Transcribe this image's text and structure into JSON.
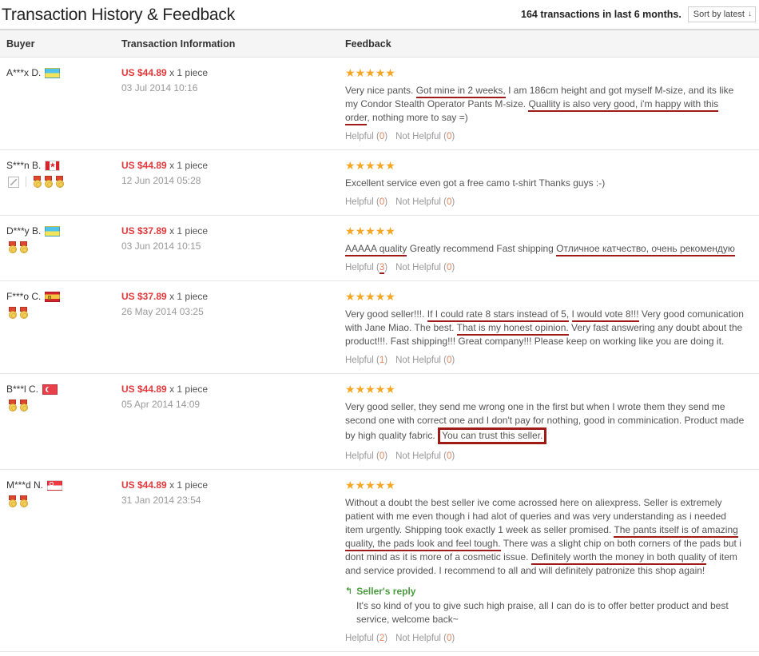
{
  "header": {
    "title": "Transaction History & Feedback",
    "transactions_summary": "164 transactions in last 6 months.",
    "sort_label": "Sort by latest",
    "sort_arrow": "↓"
  },
  "table": {
    "columns": {
      "buyer": "Buyer",
      "transaction_information": "Transaction Information",
      "feedback": "Feedback"
    },
    "helpful_label": "Helpful",
    "not_helpful_label": "Not Helpful",
    "quantity_suffix": "x 1 piece",
    "seller_reply_label": "Seller's reply",
    "seller_reply_icon": "reply-arrow-icon"
  },
  "rows": [
    {
      "buyer": "A***x D.",
      "flag": "flag-ua",
      "flag_name": "ukraine",
      "has_photo_icon": false,
      "medals": 0,
      "price": "US $44.89",
      "qty": "x 1 piece",
      "date": "03 Jul 2014 10:16",
      "stars": 5,
      "feedback_parts": [
        {
          "t": "Very nice pants. ",
          "s": "plain"
        },
        {
          "t": "Got mine in 2 weeks,",
          "s": "underline"
        },
        {
          "t": " I am 186cm height and got myself M-size, and its like my Condor Stealth Operator Pants M-size. ",
          "s": "plain"
        },
        {
          "t": "Quallity is also very good, i'm happy with this order",
          "s": "underline"
        },
        {
          "t": ", nothing more to say =)",
          "s": "plain"
        }
      ],
      "helpful": "0",
      "not_helpful": "0",
      "helpful_annotated": false,
      "reply": null
    },
    {
      "buyer": "S***n B.",
      "flag": "flag-ca",
      "flag_name": "canada",
      "has_photo_icon": true,
      "medals": 3,
      "price": "US $44.89",
      "qty": "x 1 piece",
      "date": "12 Jun 2014 05:28",
      "stars": 5,
      "feedback_parts": [
        {
          "t": "Excellent service even got a free camo t-shirt Thanks guys :-)",
          "s": "plain"
        }
      ],
      "helpful": "0",
      "not_helpful": "0",
      "helpful_annotated": false,
      "reply": null
    },
    {
      "buyer": "D***y B.",
      "flag": "flag-ua",
      "flag_name": "ukraine",
      "has_photo_icon": false,
      "medals": 2,
      "price": "US $37.89",
      "qty": "x 1 piece",
      "date": "03 Jun 2014 10:15",
      "stars": 5,
      "feedback_parts": [
        {
          "t": "AAAAA quality",
          "s": "underline"
        },
        {
          "t": " Greatly recommend Fast shipping ",
          "s": "plain"
        },
        {
          "t": "Отличное катчество, очень рекомендую",
          "s": "underline"
        }
      ],
      "helpful": "3",
      "not_helpful": "0",
      "helpful_annotated": true,
      "reply": null
    },
    {
      "buyer": "F***o C.",
      "flag": "flag-es",
      "flag_name": "spain",
      "has_photo_icon": false,
      "medals": 2,
      "price": "US $37.89",
      "qty": "x 1 piece",
      "date": "26 May 2014 03:25",
      "stars": 5,
      "feedback_parts": [
        {
          "t": "Very good seller!!!. ",
          "s": "plain"
        },
        {
          "t": "If I could rate 8 stars instead of 5,",
          "s": "underline"
        },
        {
          "t": " ",
          "s": "plain"
        },
        {
          "t": "I would vote 8!!!",
          "s": "underline"
        },
        {
          "t": " Very good comunication with Jane Miao. The best. ",
          "s": "plain"
        },
        {
          "t": "That is my honest opinion.",
          "s": "underline"
        },
        {
          "t": " Very fast answering any doubt about the product!!!. Fast shipping!!! Great company!!! Please keep on working like you are doing it.",
          "s": "plain"
        }
      ],
      "helpful": "1",
      "not_helpful": "0",
      "helpful_annotated": false,
      "reply": null
    },
    {
      "buyer": "B***l C.",
      "flag": "flag-tr",
      "flag_name": "turkey",
      "has_photo_icon": false,
      "medals": 2,
      "price": "US $44.89",
      "qty": "x 1 piece",
      "date": "05 Apr 2014 14:09",
      "stars": 5,
      "feedback_parts": [
        {
          "t": "Very good seller, they send me wrong one in the first but when I wrote them they send me second one with correct one and I don't pay for nothing, good in comminication. Product made by high quality fabric. ",
          "s": "plain"
        },
        {
          "t": "You can trust this seller.",
          "s": "boxed"
        }
      ],
      "helpful": "0",
      "not_helpful": "0",
      "helpful_annotated": false,
      "reply": null
    },
    {
      "buyer": "M***d N.",
      "flag": "flag-sg",
      "flag_name": "singapore",
      "has_photo_icon": false,
      "medals": 2,
      "price": "US $44.89",
      "qty": "x 1 piece",
      "date": "31 Jan 2014 23:54",
      "stars": 5,
      "feedback_parts": [
        {
          "t": "Without a doubt the best seller ive come acrossed here on aliexpress. Seller is extremely patient with me even though i had alot of queries and was very understanding as i needed item urgently. Shipping took exactly 1 week as seller promised. ",
          "s": "plain"
        },
        {
          "t": "The pants itself is of amazing quality, the pads look and feel tough.",
          "s": "underline"
        },
        {
          "t": " There was a slight chip on both corners of the pads but i dont mind as it is more of a cosmetic issue. ",
          "s": "plain"
        },
        {
          "t": "Definitely worth the money in both quality",
          "s": "underline"
        },
        {
          "t": " of item and service provided. I recommend to all and will definitely patronize this shop again!",
          "s": "plain"
        }
      ],
      "helpful": "2",
      "not_helpful": "0",
      "helpful_annotated": false,
      "reply": {
        "label": "Seller's reply",
        "text": "It's so kind of you to give such high praise, all I can do is to offer better product and best service, welcome back~"
      }
    }
  ],
  "colors": {
    "price": "#e4393c",
    "star": "#f5a623",
    "annotation": "#9e1b17",
    "reply_green": "#4a9c3f",
    "count": "#e4835a"
  }
}
